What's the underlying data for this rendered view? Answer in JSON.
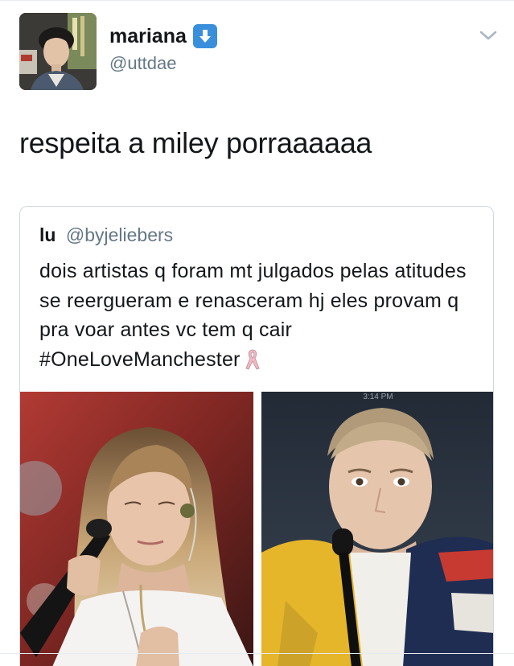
{
  "tweet": {
    "display_name": "mariana",
    "handle": "@uttdae",
    "badge_icon": "down-arrow-emoji-icon",
    "text": "respeita a miley porraaaaaa"
  },
  "quoted_tweet": {
    "display_name": "lu",
    "handle": "@byjeliebers",
    "text": "dois artistas q foram mt julgados pelas atitudes se reergueram e renasceram hj eles provam q pra voar antes vc tem q cair #OneLoveManchester",
    "trailing_icon": "ribbon-emoji-icon",
    "photo_timestamp": "3:14 PM"
  },
  "colors": {
    "text": "#14171a",
    "secondary": "#657786",
    "border": "#cfd9de",
    "badge": "#3a8fdd"
  }
}
